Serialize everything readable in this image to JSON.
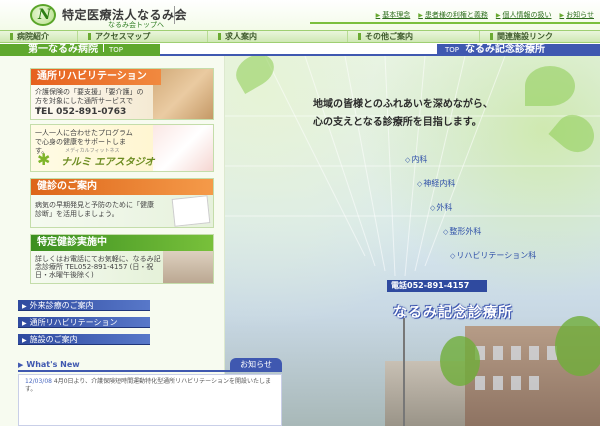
{
  "header": {
    "logo_letter": "N",
    "org_name": "特定医療法人なるみ会",
    "org_sub": "なるみ会トップへ",
    "top_links": [
      "基本理念",
      "患者様の利権と義務",
      "個人情報の扱い",
      "お知らせ"
    ]
  },
  "nav": {
    "items": [
      "病院紹介",
      "アクセスマップ",
      "求人案内",
      "その他ご案内",
      "関連施設リンク"
    ]
  },
  "sections": {
    "left_hospital": "第一なるみ病院",
    "left_top": "TOP",
    "right_top": "TOP",
    "right_hospital": "なるみ記念診療所"
  },
  "cards": {
    "rehab": {
      "title": "通所リハビリテーション",
      "desc": "介護保険の「要支援」「要介護」の方を対象にした通所サービスです。",
      "tel": "TEL 052-891-0763"
    },
    "studio": {
      "desc": "一人一人に合わせたプログラムで心身の健康をサポートします。",
      "sub": "メディカルフィットネス",
      "brand": "ナルミ エアスタジオ",
      "figure": "✱"
    },
    "checkup": {
      "title": "健診のご案内",
      "desc": "病気の早期発見と予防のために「健康診断」を活用しましょう。"
    },
    "checkup_special": {
      "title": "特定健診実施中",
      "desc": "詳しくはお電話にてお気軽に、なるみ記念診療所 TEL052-891-4157 (日・祝日・水曜午後除く)"
    }
  },
  "side_links": [
    "外来診療のご案内",
    "通所リハビリテーション",
    "施設のご案内"
  ],
  "whats_new": {
    "title": "What's New",
    "tag": "お知らせ",
    "date": "12/03/08",
    "text": "4月0日より、介護保険短時間運動特化型通所リハビリテーションを開設いたします。"
  },
  "hero": {
    "tagline_1": "地域の皆様とのふれあいを深めながら、",
    "tagline_2": "心の支えとなる診療所を目指します。",
    "departments": [
      "内科",
      "神経内科",
      "外科",
      "整形外科",
      "リハビリテーション科"
    ],
    "phone": "電話052-891-4157",
    "clinic_name": "なるみ記念診療所"
  },
  "colors": {
    "green": "#5fa82e",
    "blue": "#3f58b0",
    "orange": "#e6601e"
  }
}
